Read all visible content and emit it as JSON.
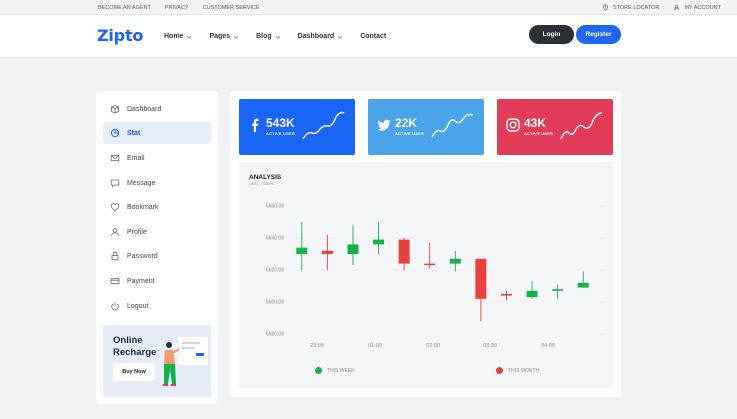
{
  "topbar": {
    "left": [
      "BECOME AN AGENT",
      "PRIVACY",
      "CUSTOMER SERVICE"
    ],
    "store_locator": "STORE LOCATOR",
    "my_account": "MY ACCOUNT"
  },
  "header": {
    "logo": "Zipto",
    "nav": [
      "Home",
      "Pages",
      "Blog",
      "Dashboard",
      "Contact"
    ],
    "login": "Login",
    "register": "Register"
  },
  "sidebar": {
    "items": [
      {
        "label": "Dashboard",
        "icon": "box-icon"
      },
      {
        "label": "Stat",
        "icon": "pie-chart-icon",
        "active": true
      },
      {
        "label": "Email",
        "icon": "mail-icon"
      },
      {
        "label": "Message",
        "icon": "message-icon"
      },
      {
        "label": "Bookmark",
        "icon": "heart-icon"
      },
      {
        "label": "Profile",
        "icon": "user-icon"
      },
      {
        "label": "Password",
        "icon": "lock-icon"
      },
      {
        "label": "Payment",
        "icon": "credit-card-icon"
      },
      {
        "label": "Logout",
        "icon": "power-icon"
      }
    ],
    "promo_title": "Online Recharge",
    "promo_button": "Buy Now"
  },
  "cards": [
    {
      "count": "543K",
      "label": "ACTIVE USER",
      "icon": "facebook-icon",
      "color": "#1a66f4"
    },
    {
      "count": "22K",
      "label": "ACTIVE USER",
      "icon": "twitter-icon",
      "color": "#4aa4e8"
    },
    {
      "count": "43K",
      "label": "ACTIVE USER",
      "icon": "instagram-icon",
      "color": "#e23c58"
    }
  ],
  "chart": {
    "title": "ANALYSIS",
    "subtitle": "LAST 7 DAYS",
    "legend": [
      {
        "label": "THIS WEEK",
        "color": "#17b14c"
      },
      {
        "label": "THIS MONTH",
        "color": "#e8403c"
      }
    ]
  },
  "chart_data": {
    "type": "candlestick",
    "title": "ANALYSIS",
    "y_ticks": [
      "6660.00",
      "6640.00",
      "6620.00",
      "6600.00",
      "6580.00"
    ],
    "x_ticks": [
      "23:00",
      "01:00",
      "02:00",
      "03:00",
      "04:00"
    ],
    "ylim": [
      6580,
      6660
    ],
    "colors": {
      "up": "#17b14c",
      "down": "#e8403c"
    },
    "candles": [
      {
        "open": 6630,
        "close": 6634,
        "high": 6650,
        "low": 6620,
        "dir": "up"
      },
      {
        "open": 6632,
        "close": 6630,
        "high": 6642,
        "low": 6620,
        "dir": "down"
      },
      {
        "open": 6630,
        "close": 6636,
        "high": 6648,
        "low": 6623,
        "dir": "up"
      },
      {
        "open": 6636,
        "close": 6639,
        "high": 6650,
        "low": 6630,
        "dir": "up"
      },
      {
        "open": 6639,
        "close": 6624,
        "high": 6640,
        "low": 6620,
        "dir": "down"
      },
      {
        "open": 6624,
        "close": 6624,
        "high": 6637,
        "low": 6621,
        "dir": "down"
      },
      {
        "open": 6624,
        "close": 6627,
        "high": 6632,
        "low": 6619,
        "dir": "up"
      },
      {
        "open": 6627,
        "close": 6602,
        "high": 6627,
        "low": 6588,
        "dir": "down"
      },
      {
        "open": 6605,
        "close": 6604,
        "high": 6607,
        "low": 6601,
        "dir": "down"
      },
      {
        "open": 6603,
        "close": 6607,
        "high": 6613,
        "low": 6602,
        "dir": "up"
      },
      {
        "open": 6607,
        "close": 6608,
        "high": 6611,
        "low": 6602,
        "dir": "up"
      },
      {
        "open": 6609,
        "close": 6612,
        "high": 6619,
        "low": 6609,
        "dir": "up"
      }
    ]
  }
}
